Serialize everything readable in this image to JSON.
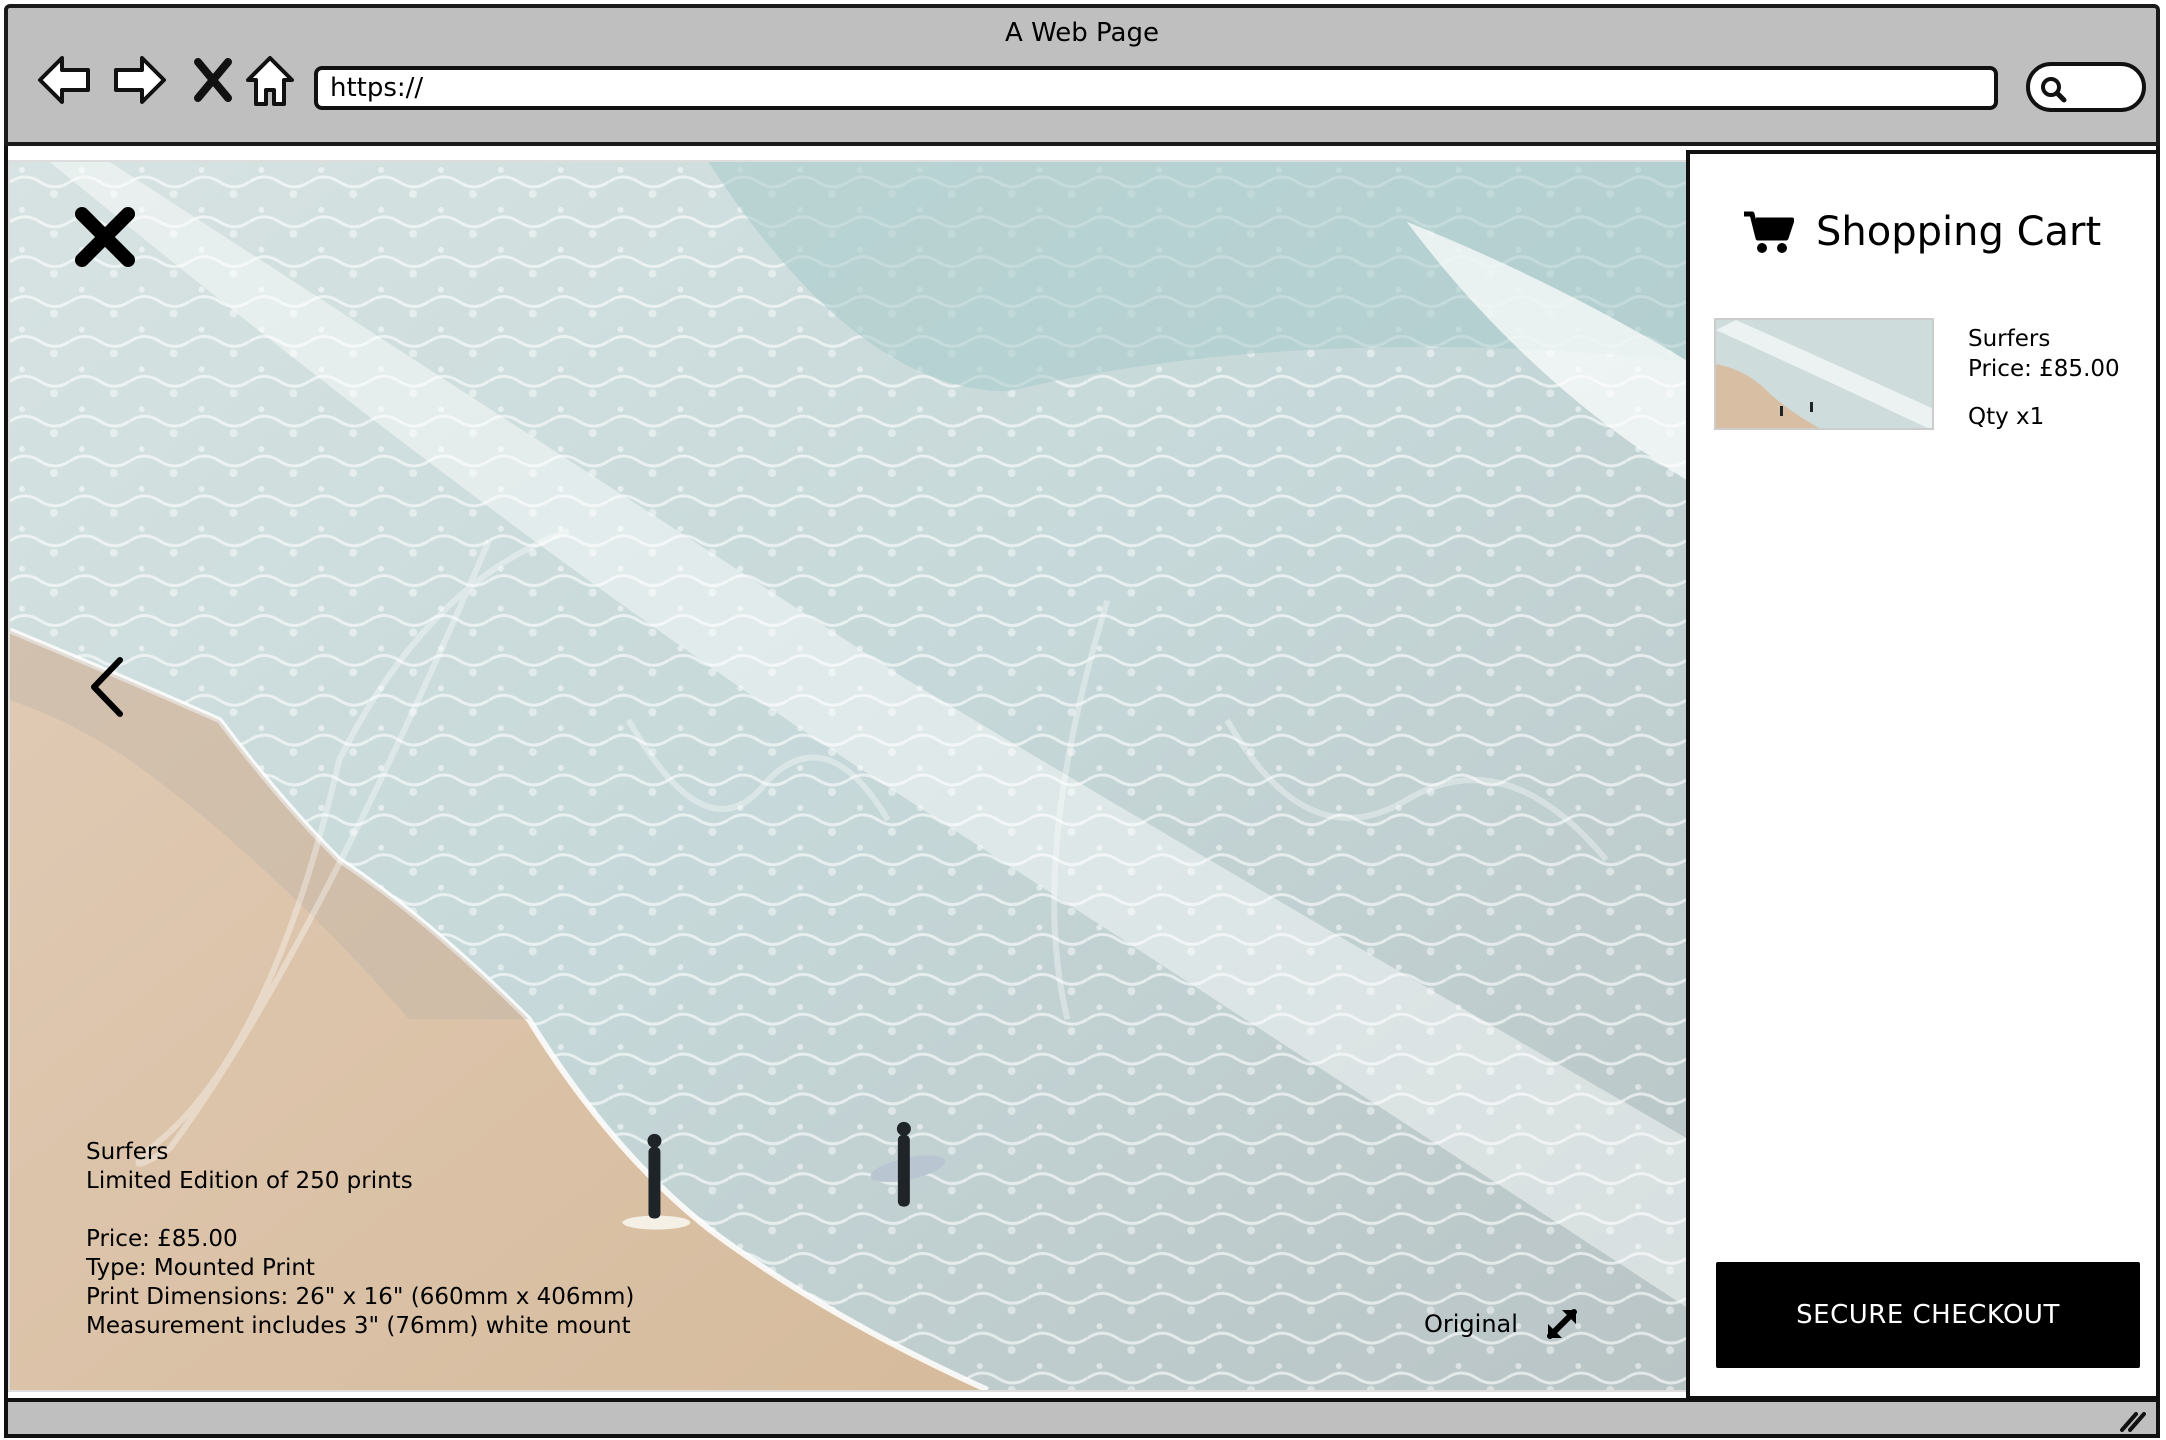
{
  "browser": {
    "title": "A Web Page",
    "url": "https://",
    "icons": [
      "back-arrow-icon",
      "forward-arrow-icon",
      "stop-icon",
      "home-icon",
      "search-icon"
    ]
  },
  "viewer": {
    "image_subject": "Aerial photo of two surfers walking on a beach at the water's edge",
    "info": {
      "title": "Surfers",
      "edition": "Limited Edition of 250 prints",
      "price": "Price: £85.00",
      "type": "Type: Mounted Print",
      "dimensions": "Print Dimensions: 26\" x 16\" (660mm x 406mm)",
      "mount": "Measurement includes 3\" (76mm) white mount"
    },
    "original_label": "Original",
    "icons": [
      "close-icon",
      "chevron-left-icon",
      "expand-icon"
    ]
  },
  "cart": {
    "title": "Shopping Cart",
    "icon": "cart-icon",
    "items": [
      {
        "name": "Surfers",
        "price": "Price: £85.00",
        "qty": "Qty x1"
      }
    ],
    "checkout_label": "SECURE CHECKOUT"
  },
  "colors": {
    "chrome": "#bfbfbf",
    "outline": "#111111",
    "sand": "#d9bfa3",
    "sea": "#c9d9d8",
    "foam": "#f4f7f7",
    "checkout_bg": "#000000"
  }
}
